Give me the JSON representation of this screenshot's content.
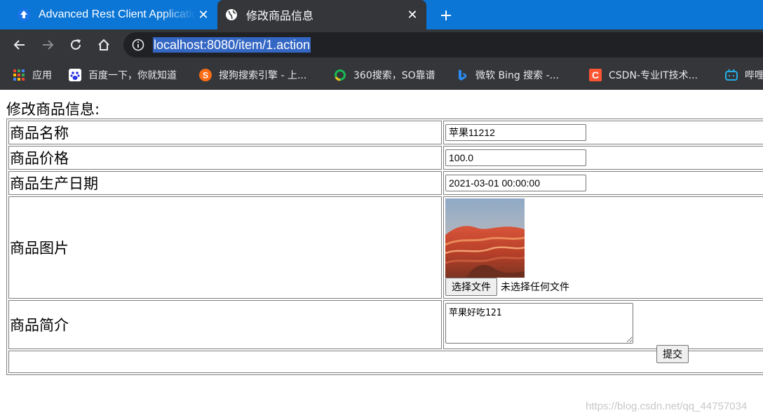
{
  "browser": {
    "tabs": [
      {
        "title": "Advanced Rest Client Application",
        "icon": "arc-upload-arrow-icon",
        "active": false
      },
      {
        "title": "修改商品信息",
        "icon": "globe-icon",
        "active": true
      }
    ],
    "url": "localhost:8080/item/1.action",
    "bookmarks": [
      {
        "label": "应用",
        "icon": "apps-grid-icon"
      },
      {
        "label": "百度一下，你就知道",
        "icon": "baidu-paw-icon"
      },
      {
        "label": "搜狗搜索引擎 - 上...",
        "icon": "sogou-icon"
      },
      {
        "label": "360搜索，SO靠谱",
        "icon": "360-icon"
      },
      {
        "label": "微软 Bing 搜索 -...",
        "icon": "bing-icon"
      },
      {
        "label": "CSDN-专业IT技术...",
        "icon": "csdn-icon"
      },
      {
        "label": "哔哩",
        "icon": "bilibili-icon"
      }
    ],
    "colors": {
      "tabstrip": "#0b76d6",
      "toolbar": "#35363a",
      "omnibox": "#202124",
      "url_highlight": "#3467c4"
    }
  },
  "page": {
    "heading": "修改商品信息:",
    "form": {
      "name": {
        "label": "商品名称",
        "value": "苹果11212"
      },
      "price": {
        "label": "商品价格",
        "value": "100.0"
      },
      "createtime": {
        "label": "商品生产日期",
        "value": "2021-03-01 00:00:00"
      },
      "pic": {
        "label": "商品图片",
        "choose_button": "选择文件",
        "no_file_text": "未选择任何文件"
      },
      "detail": {
        "label": "商品简介",
        "value": "苹果好吃121"
      },
      "submit": "提交"
    },
    "watermark": "https://blog.csdn.net/qq_44757034"
  }
}
